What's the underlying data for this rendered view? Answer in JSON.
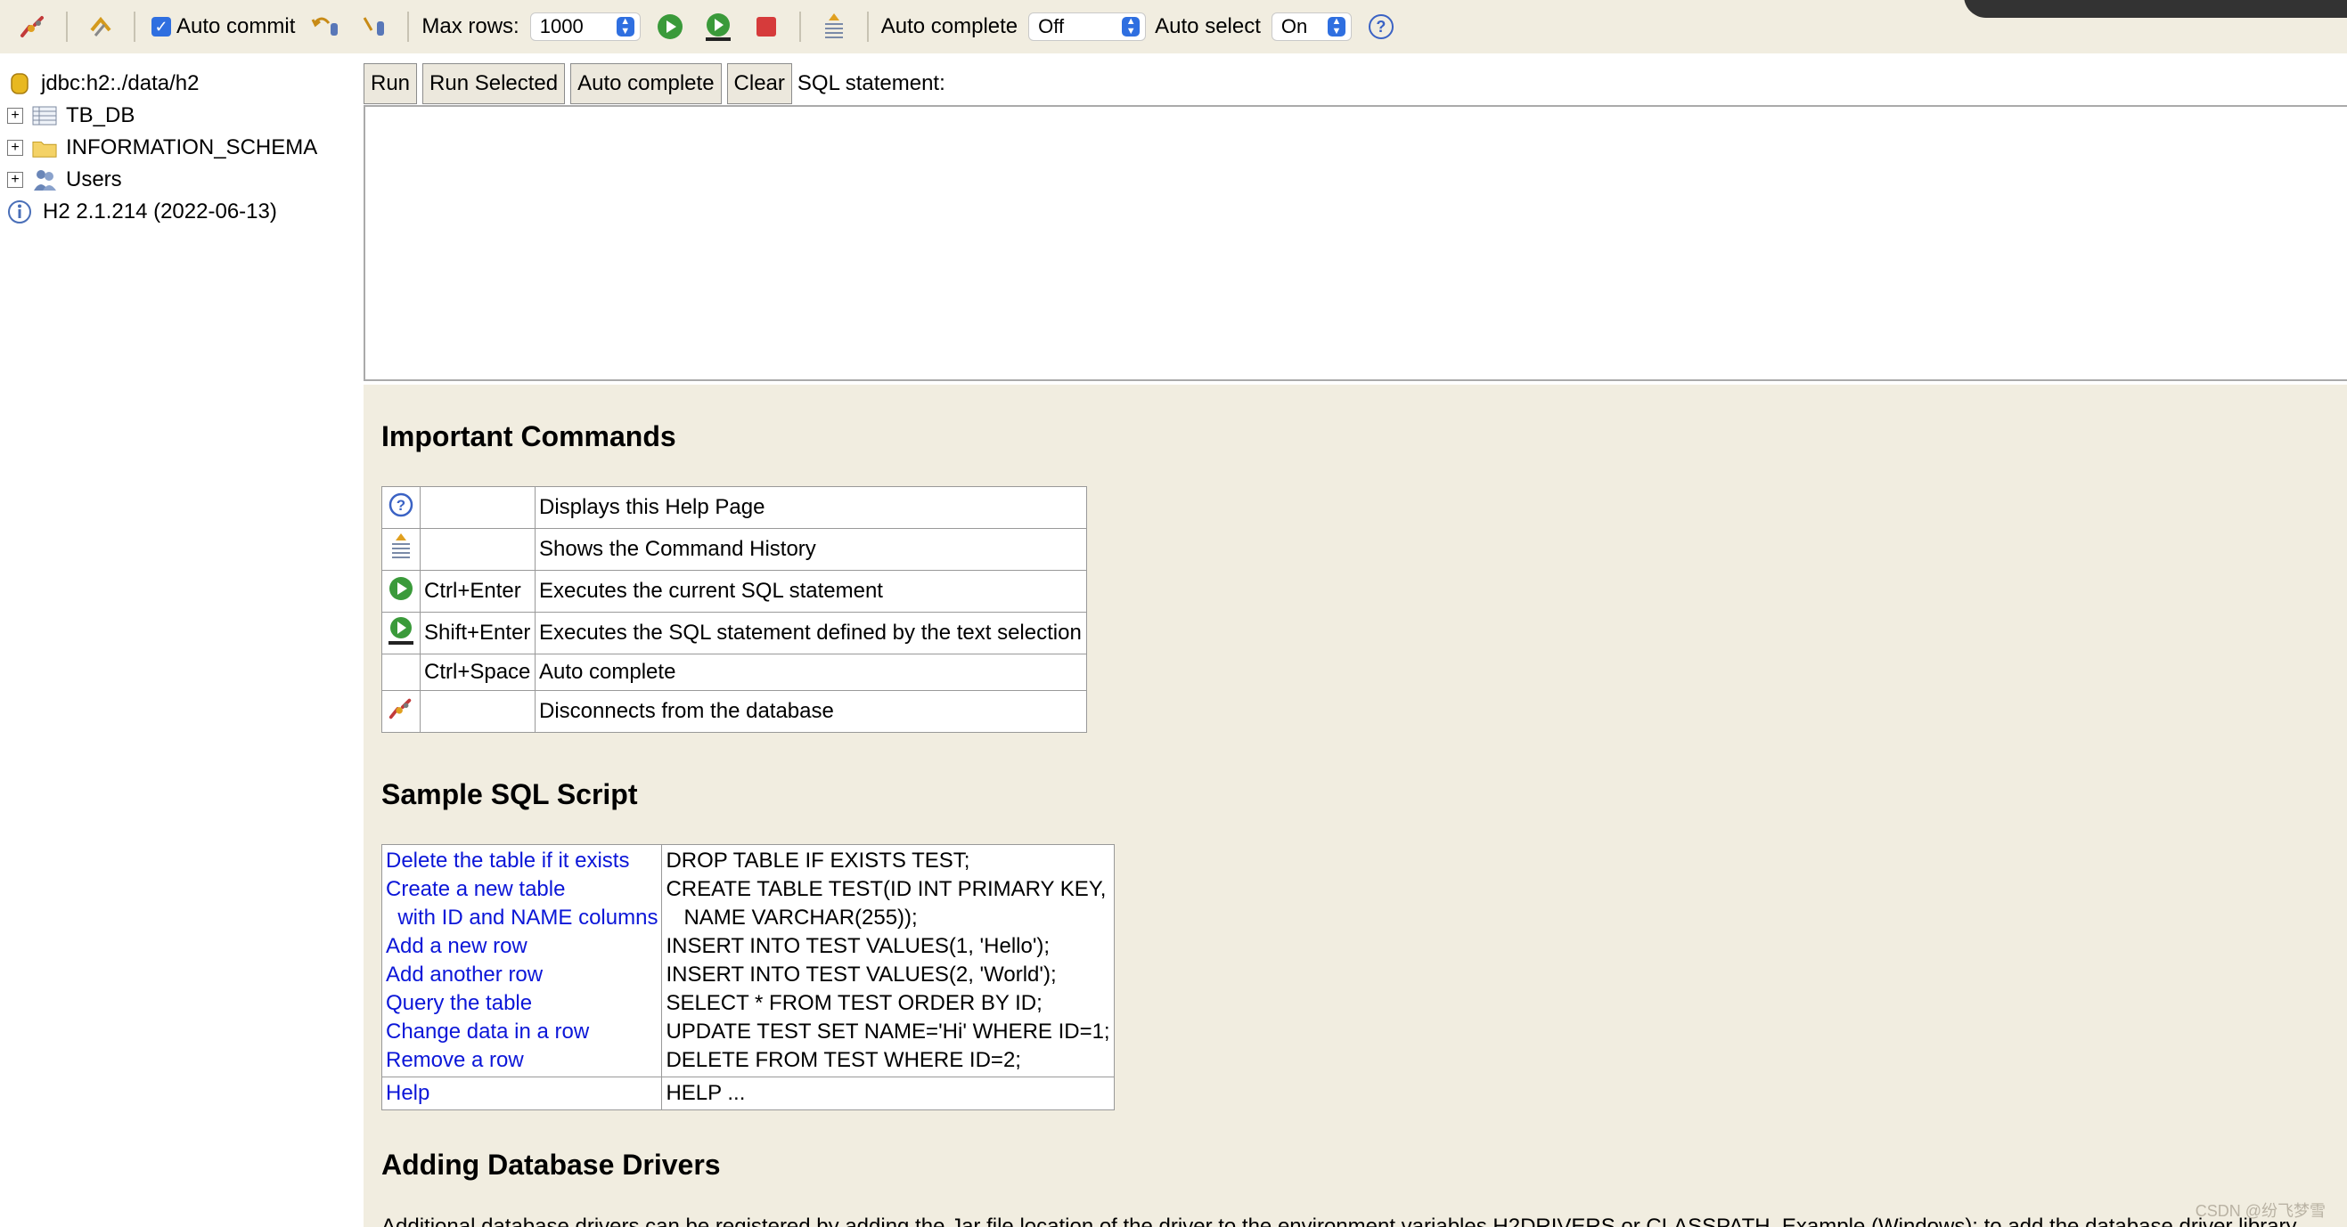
{
  "toolbar": {
    "auto_commit_label": "Auto commit",
    "max_rows_label": "Max rows:",
    "max_rows_value": "1000",
    "auto_complete_label": "Auto complete",
    "auto_complete_value": "Off",
    "auto_select_label": "Auto select",
    "auto_select_value": "On",
    "help_glyph": "?"
  },
  "tree": {
    "connection": "jdbc:h2:./data/h2",
    "items": [
      {
        "label": "TB_DB"
      },
      {
        "label": "INFORMATION_SCHEMA"
      },
      {
        "label": "Users"
      }
    ],
    "version": "H2 2.1.214 (2022-06-13)"
  },
  "sqlbar": {
    "run": "Run",
    "run_selected": "Run Selected",
    "auto_complete": "Auto complete",
    "clear": "Clear",
    "statement_label": "SQL statement:"
  },
  "important": {
    "title": "Important Commands",
    "rows": [
      {
        "key": "",
        "desc": "Displays this Help Page"
      },
      {
        "key": "",
        "desc": "Shows the Command History"
      },
      {
        "key": "Ctrl+Enter",
        "desc": "Executes the current SQL statement"
      },
      {
        "key": "Shift+Enter",
        "desc": "Executes the SQL statement defined by the text selection"
      },
      {
        "key": "Ctrl+Space",
        "desc": "Auto complete"
      },
      {
        "key": "",
        "desc": "Disconnects from the database"
      }
    ]
  },
  "sample": {
    "title": "Sample SQL Script",
    "links": [
      "Delete the table if it exists",
      "Create a new table",
      "  with ID and NAME columns",
      "Add a new row",
      "Add another row",
      "Query the table",
      "Change data in a row",
      "Remove a row"
    ],
    "code": [
      "DROP TABLE IF EXISTS TEST;",
      "CREATE TABLE TEST(ID INT PRIMARY KEY,",
      "   NAME VARCHAR(255));",
      "INSERT INTO TEST VALUES(1, 'Hello');",
      "INSERT INTO TEST VALUES(2, 'World');",
      "SELECT * FROM TEST ORDER BY ID;",
      "UPDATE TEST SET NAME='Hi' WHERE ID=1;",
      "DELETE FROM TEST WHERE ID=2;"
    ],
    "help_link": "Help",
    "help_code": "HELP ..."
  },
  "drivers": {
    "title": "Adding Database Drivers",
    "text": "Additional database drivers can be registered by adding the Jar file location of the driver to the environment variables H2DRIVERS or CLASSPATH. Example (Windows): to add the database driver library"
  },
  "watermark": "CSDN @纷飞梦雪"
}
